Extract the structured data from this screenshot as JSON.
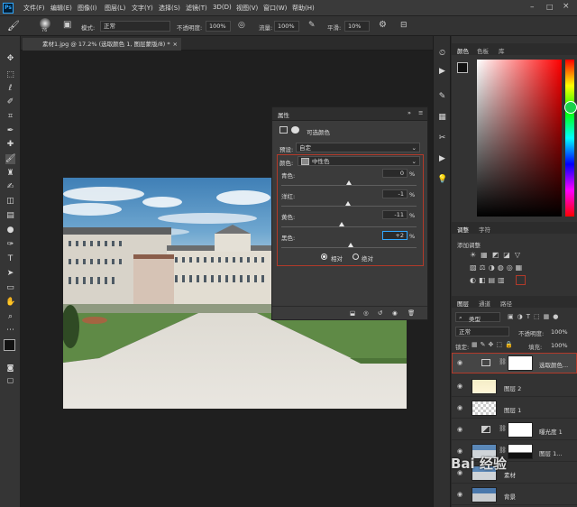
{
  "menu": {
    "app_icon": "Ps",
    "items": [
      "文件(F)",
      "编辑(E)",
      "图像(I)",
      "图层(L)",
      "文字(Y)",
      "选择(S)",
      "滤镜(T)",
      "3D(D)",
      "视图(V)",
      "窗口(W)",
      "帮助(H)"
    ]
  },
  "options": {
    "brush_size": "76",
    "mode_label": "模式:",
    "mode_value": "正常",
    "opacity_label": "不透明度:",
    "opacity_value": "100%",
    "flow_label": "流量:",
    "flow_value": "100%",
    "smooth_label": "平滑:",
    "smooth_value": "10%"
  },
  "document": {
    "tab_title": "素材1.jpg @ 17.2% (选取颜色 1, 图层蒙版/8) *",
    "close": "×"
  },
  "properties": {
    "panel_title": "属性",
    "collapse": "»",
    "menu": "≡",
    "adjust_title": "可选颜色",
    "preset_label": "预设:",
    "preset_value": "自定",
    "color_label": "颜色:",
    "color_value": "中性色",
    "sliders": [
      {
        "label": "青色:",
        "value": "0",
        "pct": "%",
        "level": 0
      },
      {
        "label": "洋红:",
        "value": "-1",
        "pct": "%",
        "level": -1
      },
      {
        "label": "黄色:",
        "value": "-11",
        "pct": "%",
        "level": -11
      },
      {
        "label": "黑色:",
        "value": "+2",
        "pct": "%",
        "level": 2
      }
    ],
    "method_relative": "相对",
    "method_absolute": "绝对"
  },
  "right": {
    "color_tabs": [
      "颜色",
      "色板",
      "库"
    ],
    "adjust_tabs": [
      "调整",
      "字符"
    ],
    "add_adjustment": "添加调整",
    "layer_tabs": [
      "图层",
      "通道",
      "路径"
    ],
    "filter_kind": "类型",
    "blend_mode": "正常",
    "opacity_label": "不透明度:",
    "opacity_value": "100%",
    "lock_label": "锁定:",
    "fill_label": "填充:",
    "fill_value": "100%",
    "layers": [
      {
        "name": "选取颜色..."
      },
      {
        "name": "图层 2"
      },
      {
        "name": "图层 1"
      },
      {
        "name": "曝光度 1"
      },
      {
        "name": "图层 1..."
      },
      {
        "name": "素材"
      },
      {
        "name": "背景"
      }
    ]
  },
  "watermark": "Bai 经验",
  "colors": {
    "accent_red": "#b23a2a",
    "ps_blue": "#31a8ff"
  }
}
